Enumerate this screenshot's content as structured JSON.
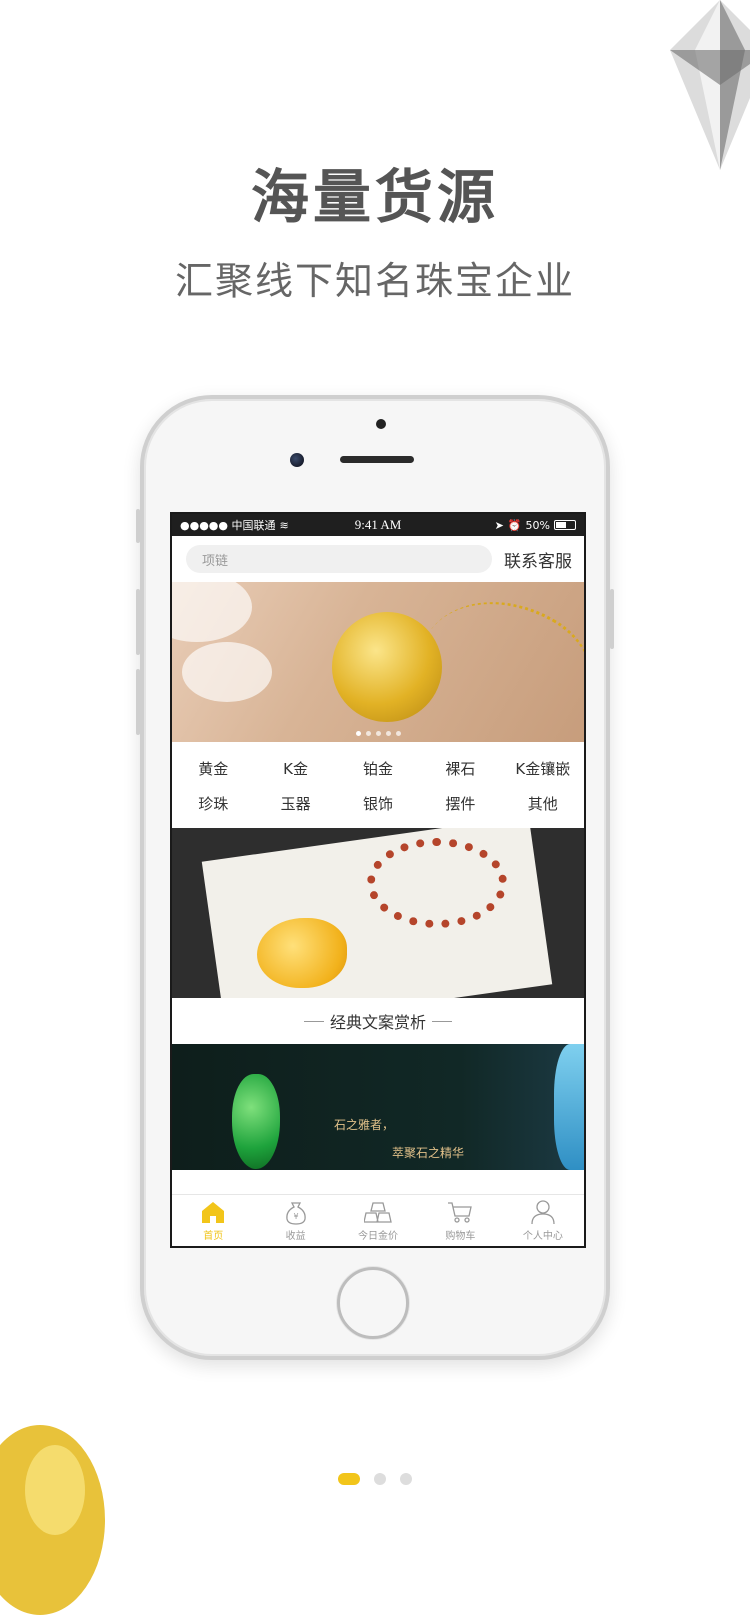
{
  "promo": {
    "headline": "海量货源",
    "subline": "汇聚线下知名珠宝企业"
  },
  "status_bar": {
    "carrier": "●●●●● 中国联通",
    "time": "9:41 AM",
    "battery": "50%"
  },
  "search": {
    "placeholder": "项链",
    "contact_label": "联系客服"
  },
  "banner": {
    "slide_count": 5,
    "active_slide": 1
  },
  "categories": [
    {
      "label": "黄金"
    },
    {
      "label": "K金"
    },
    {
      "label": "铂金"
    },
    {
      "label": "裸石"
    },
    {
      "label": "K金镶嵌"
    },
    {
      "label": "珍珠"
    },
    {
      "label": "玉器"
    },
    {
      "label": "银饰"
    },
    {
      "label": "摆件"
    },
    {
      "label": "其他"
    }
  ],
  "section": {
    "title": "经典文案赏析"
  },
  "jade_banner": {
    "line1": "石之雅者，",
    "line2": "萃聚石之精华"
  },
  "tabbar": [
    {
      "label": "首页",
      "icon": "home-icon",
      "active": true
    },
    {
      "label": "收益",
      "icon": "money-bag-icon",
      "active": false
    },
    {
      "label": "今日金价",
      "icon": "gold-bars-icon",
      "active": false
    },
    {
      "label": "购物车",
      "icon": "cart-icon",
      "active": false
    },
    {
      "label": "个人中心",
      "icon": "user-icon",
      "active": false
    }
  ],
  "pager": {
    "pages": 3,
    "active": 1
  },
  "colors": {
    "accent": "#f2c51a",
    "text": "#333333",
    "muted": "#999999"
  }
}
